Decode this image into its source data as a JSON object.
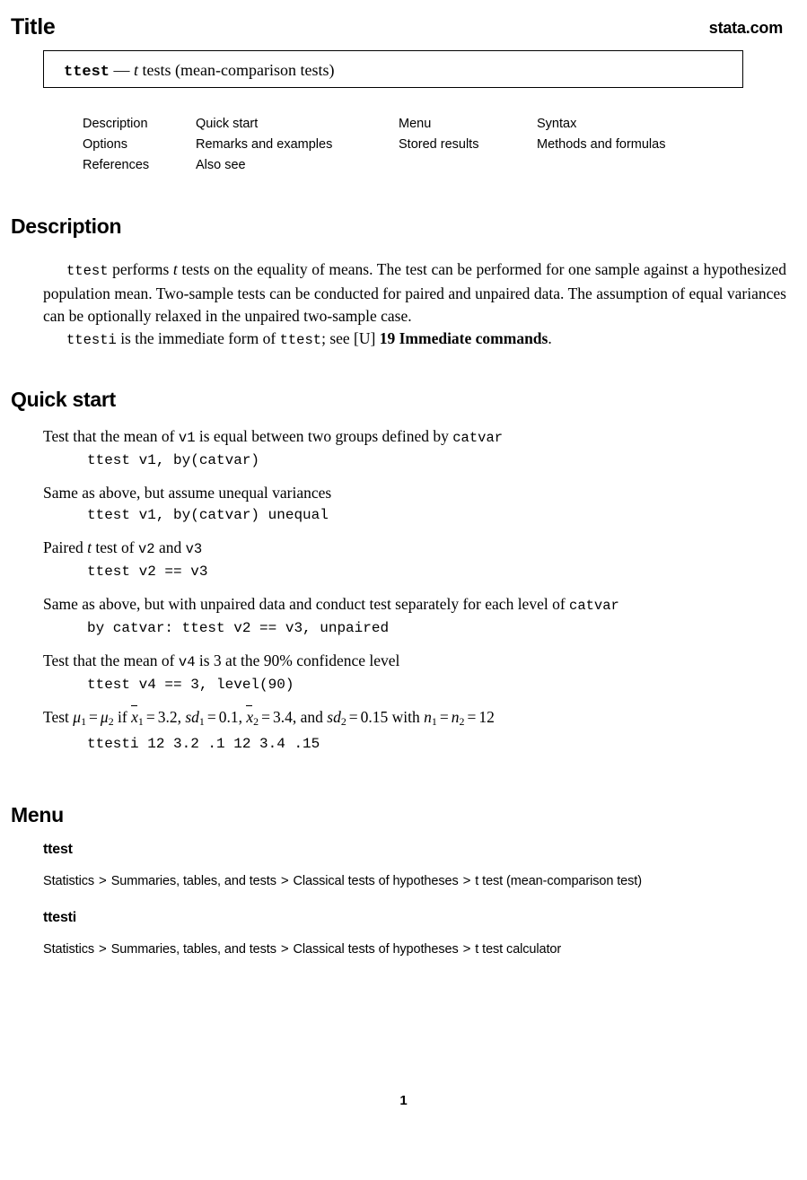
{
  "header": {
    "title": "Title",
    "site": "stata.com"
  },
  "title_box": {
    "command": "ttest",
    "dash": "—",
    "t_italic": "t",
    "rest": " tests (mean-comparison tests)"
  },
  "toc": {
    "rows": [
      [
        "Description",
        "Quick start",
        "Menu",
        "Syntax"
      ],
      [
        "Options",
        "Remarks and examples",
        "Stored results",
        "Methods and formulas"
      ],
      [
        "References",
        "Also see",
        "",
        ""
      ]
    ]
  },
  "sections": {
    "description": {
      "heading": "Description",
      "p1_a": "ttest",
      "p1_b": " performs ",
      "p1_t": "t",
      "p1_c": " tests on the equality of means. The test can be performed for one sample against a hypothesized population mean. Two-sample tests can be conducted for paired and unpaired data. The assumption of equal variances can be optionally relaxed in the unpaired two-sample case.",
      "p2_a": "ttesti",
      "p2_b": " is the immediate form of ",
      "p2_c": "ttest",
      "p2_d": "; see [U] ",
      "p2_e": "19 Immediate commands",
      "p2_f": "."
    },
    "quick_start": {
      "heading": "Quick start",
      "items": [
        {
          "desc_pre": "Test that the mean of ",
          "desc_mono1": "v1",
          "desc_mid": " is equal between two groups defined by ",
          "desc_mono2": "catvar",
          "desc_post": "",
          "code": "ttest v1, by(catvar)"
        },
        {
          "desc_pre": "Same as above, but assume unequal variances",
          "desc_mono1": "",
          "desc_mid": "",
          "desc_mono2": "",
          "desc_post": "",
          "code": "ttest v1, by(catvar) unequal"
        },
        {
          "desc_pre": "Paired ",
          "desc_italic": "t",
          "desc_mid": " test of ",
          "desc_mono1": "v2",
          "desc_mid2": " and ",
          "desc_mono2": "v3",
          "code": "ttest v2 == v3"
        },
        {
          "desc_pre": "Same as above, but with unpaired data and conduct test separately for each level of ",
          "desc_mono2": "catvar",
          "code": "by catvar: ttest v2 == v3, unpaired"
        },
        {
          "desc_pre": "Test that the mean of ",
          "desc_mono1": "v4",
          "desc_mid": " is 3 at the 90% confidence level",
          "code": "ttest v4 == 3, level(90)"
        },
        {
          "math": true,
          "code": "ttesti 12 3.2 .1 12 3.4 .15",
          "math_parts": {
            "lead": "Test ",
            "mu1": "μ",
            "mu1_sub": "1",
            "eq1": "=",
            "mu2": "μ",
            "mu2_sub": "2",
            "if": " if ",
            "xbar1": "x",
            "xbar1_sub": "1",
            "eq2": "=",
            "val1": "3.2",
            "comma1": ", ",
            "sd1": "sd",
            "sd1_sub": "1",
            "eq3": "=",
            "val2": "0.1",
            "comma2": ", ",
            "xbar2": "x",
            "xbar2_sub": "2",
            "eq4": "=",
            "val3": "3.4",
            "and": ", and ",
            "sd2": "sd",
            "sd2_sub": "2",
            "eq5": "=",
            "val4": "0.15",
            "with": " with ",
            "n1": "n",
            "n1_sub": "1",
            "eq6": "=",
            "n2": "n",
            "n2_sub": "2",
            "eq7": "=",
            "val5": "12"
          }
        }
      ]
    },
    "menu": {
      "heading": "Menu",
      "entries": [
        {
          "name": "ttest",
          "path": [
            "Statistics",
            "Summaries, tables, and tests",
            "Classical tests of hypotheses",
            "t test (mean-comparison test)"
          ]
        },
        {
          "name": "ttesti",
          "path": [
            "Statistics",
            "Summaries, tables, and tests",
            "Classical tests of hypotheses",
            "t test calculator"
          ]
        }
      ],
      "separator": ">"
    }
  },
  "footer": {
    "page_number": "1"
  }
}
